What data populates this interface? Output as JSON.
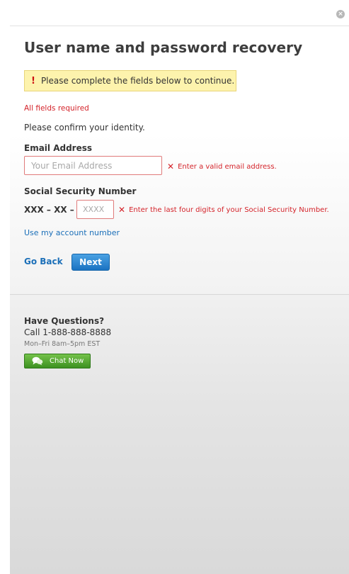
{
  "dialog": {
    "close_glyph": "×",
    "title": "User name and password recovery"
  },
  "alert": {
    "icon": "!",
    "message": "Please complete the fields below to continue."
  },
  "form": {
    "required_note": "All fields required",
    "instruction": "Please confirm your identity.",
    "email": {
      "label": "Email Address",
      "value": "",
      "placeholder": "Your Email Address",
      "error_glyph": "✕",
      "error": "Enter a valid email address."
    },
    "ssn": {
      "label": "Social Security Number",
      "prefix": "XXX – XX –",
      "value": "",
      "placeholder": "XXXX",
      "error_glyph": "✕",
      "error": "Enter the last four digits of your Social Security Number."
    },
    "account_link": "Use my account number",
    "go_back": "Go Back",
    "next": "Next"
  },
  "help": {
    "title": "Have Questions?",
    "phone": "Call 1-888-888-8888",
    "hours": "Mon–Fri 8am–5pm EST",
    "chat": "Chat Now",
    "chat_icon": "chat-bubbles-icon"
  },
  "colors": {
    "link": "#1b6fb8",
    "error": "#d4232a",
    "alert_bg": "#fdf3ad",
    "primary_button": "#1b73c2",
    "chat_button": "#3d9121"
  }
}
